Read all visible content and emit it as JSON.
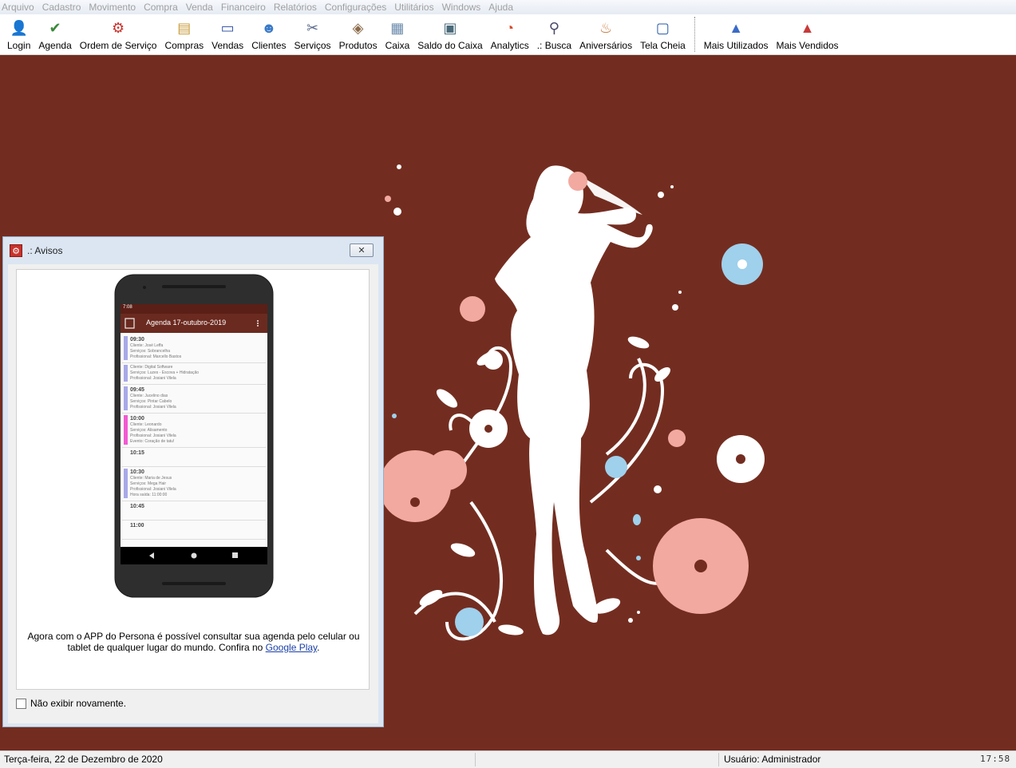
{
  "menu": [
    "Arquivo",
    "Cadastro",
    "Movimento",
    "Compra",
    "Venda",
    "Financeiro",
    "Relatórios",
    "Configurações",
    "Utilitários",
    "Windows",
    "Ajuda"
  ],
  "toolbar": {
    "group1": [
      {
        "label": "Login",
        "icon": "user-icon"
      },
      {
        "label": "Agenda",
        "icon": "calendar-check-icon"
      },
      {
        "label": "Ordem de Serviço",
        "icon": "gear-box-icon"
      },
      {
        "label": "Compras",
        "icon": "box-tag-icon"
      },
      {
        "label": "Vendas",
        "icon": "laptop-icon"
      },
      {
        "label": "Clientes",
        "icon": "people-icon"
      },
      {
        "label": "Serviços",
        "icon": "scissors-icon"
      },
      {
        "label": "Produtos",
        "icon": "products-icon"
      },
      {
        "label": "Caixa",
        "icon": "cash-box-icon"
      },
      {
        "label": "Saldo do Caixa",
        "icon": "cash-register-icon"
      },
      {
        "label": "Analytics",
        "icon": "chart-icon"
      },
      {
        "label": ".: Busca",
        "icon": "magnifier-icon"
      },
      {
        "label": "Aniversários",
        "icon": "cake-icon"
      },
      {
        "label": "Tela Cheia",
        "icon": "fullscreen-icon"
      }
    ],
    "group2": [
      {
        "label": "Mais Utilizados",
        "icon": "top-used-icon"
      },
      {
        "label": "Mais Vendidos",
        "icon": "top-sold-icon"
      }
    ]
  },
  "dialog": {
    "title": ".: Avisos",
    "message_text": "Agora com o APP do Persona é possível consultar sua agenda pelo celular ou tablet de qualquer lugar do mundo. Confira no ",
    "message_link": "Google Play",
    "message_end": ".",
    "checkbox_label": "Não exibir novamente.",
    "checkbox_checked": false
  },
  "phone": {
    "status_time": "7:08",
    "header_title": "Agenda 17-outubro-2019",
    "entries": [
      {
        "time": "09:30",
        "color": "#a8a8e8",
        "lines": [
          "Cliente: José Leffa",
          "Serviços: Sobrancelha",
          "Profissional: Marcello Bastos"
        ]
      },
      {
        "time": "",
        "color": "#a8a8e8",
        "lines": [
          "Cliente: Digital Software",
          "Serviços: Luzes - Escova + Hidratação",
          "Profissional: Josiani Vilela"
        ]
      },
      {
        "time": "09:45",
        "color": "#a8a8e8",
        "lines": [
          "Cliente: Jucelino dias",
          "Serviços: Pintar Cabelo",
          "Profissional: Josiani Vilela"
        ]
      },
      {
        "time": "10:00",
        "color": "#f25ad2",
        "lines": [
          "Cliente: Leonardo",
          "Serviços: Alisamento",
          "Profissional: Josiani Vilela",
          "Evento: Coração de tatu!"
        ]
      },
      {
        "time": "10:15",
        "color": "",
        "lines": []
      },
      {
        "time": "10:30",
        "color": "#a8a8e8",
        "lines": [
          "Cliente: Maria de Jesus",
          "Serviços: Mega Hair",
          "Profissional: Josiani Vilela",
          "Hora saída: 11:00:00"
        ]
      },
      {
        "time": "10:45",
        "color": "",
        "lines": []
      },
      {
        "time": "11:00",
        "color": "",
        "lines": []
      }
    ]
  },
  "statusbar": {
    "date": "Terça-feira, 22 de Dezembro de 2020",
    "user": "Usuário: Administrador",
    "time": "17:58"
  },
  "colors": {
    "desktop_bg": "#732d20",
    "phone_header": "#6b2a1f",
    "flower_pink": "#f2a9a0",
    "flower_blue": "#9fd0ec"
  }
}
